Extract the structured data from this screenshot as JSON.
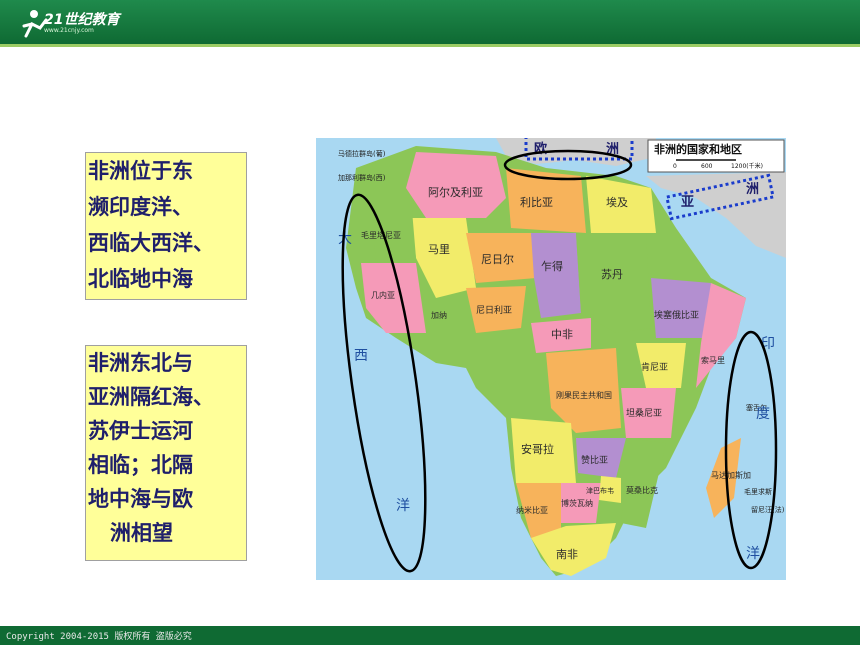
{
  "header": {
    "logo_text": "21世纪教育",
    "logo_url": "www.21cnjy.com",
    "accent": "#1f8a4c"
  },
  "box1": {
    "lines": [
      "非洲位于东",
      "濒印度洋、",
      "西临大西洋、",
      "北临地中海"
    ]
  },
  "box2": {
    "lines": [
      "非洲东北与",
      "亚洲隔红海、",
      "苏伊士运河",
      "相临；北隔",
      "地中海与欧",
      "洲相望"
    ]
  },
  "map": {
    "title": "非洲的国家和地区",
    "scale": [
      "0",
      "600",
      "1200(千米)"
    ],
    "continent_labels": [
      "欧",
      "洲",
      "亚",
      "洲"
    ],
    "ocean_labels": [
      "大",
      "西",
      "洋",
      "印",
      "度",
      "洋"
    ],
    "country_labels": [
      "阿尔及利亚",
      "利比亚",
      "埃及",
      "马里",
      "尼日尔",
      "乍得",
      "苏丹",
      "尼日利亚",
      "中非",
      "刚果民主共和国",
      "安哥拉",
      "赞比亚",
      "坦桑尼亚",
      "肯尼亚",
      "埃塞俄比亚",
      "索马里",
      "纳米比亚",
      "博茨瓦纳",
      "南非",
      "马达加斯加",
      "毛里塔尼亚",
      "莫桑比克",
      "津巴布韦",
      "几内亚",
      "加纳"
    ],
    "small_labels": [
      "马德拉群岛(葡)",
      "加那利群岛(西)",
      "毛里求斯",
      "留尼汪(法)",
      "塞舌尔"
    ],
    "colors": {
      "ocean": "#a9d8f2",
      "pink": "#f59ab8",
      "orange": "#f7b35b",
      "green": "#8cc657",
      "purple": "#b38fd0",
      "yellow": "#f2ec6a",
      "grey": "#cfcfcf",
      "highlight": "#1a3ccc"
    }
  },
  "footer": {
    "copyright": "Copyright 2004-2015 版权所有 盗版必究"
  }
}
